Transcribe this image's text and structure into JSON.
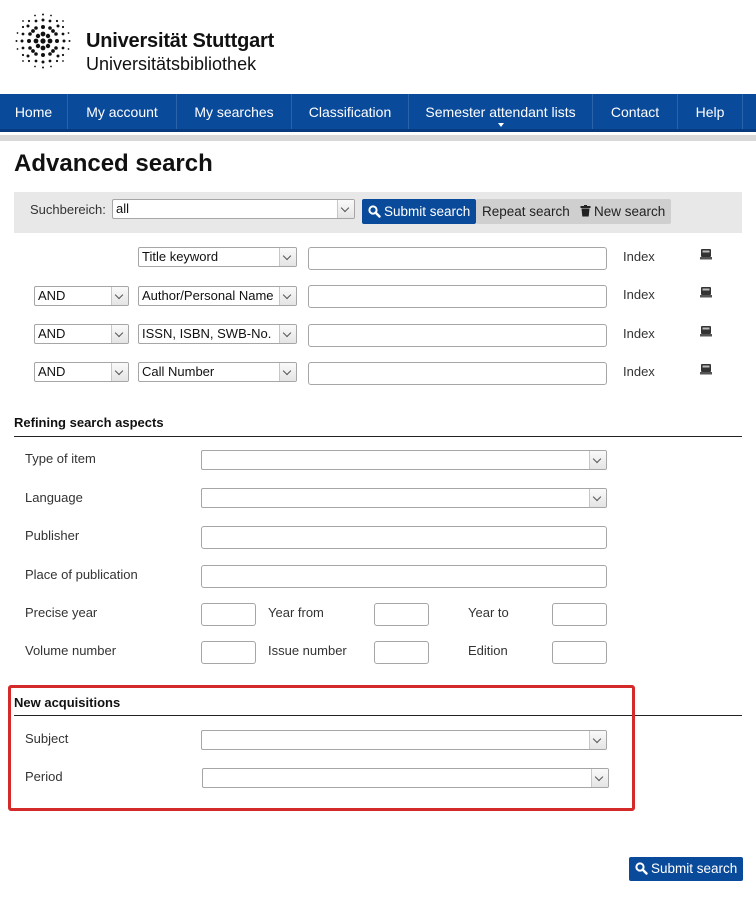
{
  "header": {
    "university": "Universität Stuttgart",
    "library": "Universitätsbibliothek"
  },
  "nav": {
    "items": [
      {
        "label": "Home"
      },
      {
        "label": "My account"
      },
      {
        "label": "My searches"
      },
      {
        "label": "Classification"
      },
      {
        "label": "Semester attendant lists"
      },
      {
        "label": "Contact"
      },
      {
        "label": "Help"
      }
    ]
  },
  "page": {
    "title": "Advanced search"
  },
  "searchbar": {
    "scope_label": "Suchbereich:",
    "scope_value": "all",
    "submit_label": "Submit search",
    "repeat_label": "Repeat search",
    "new_label": "New search"
  },
  "search_rows": [
    {
      "operator": "",
      "field": "Title keyword",
      "value": "",
      "index_label": "Index"
    },
    {
      "operator": "AND",
      "field": "Author/Personal Name",
      "value": "",
      "index_label": "Index"
    },
    {
      "operator": "AND",
      "field": "ISSN, ISBN, SWB-No.",
      "value": "",
      "index_label": "Index"
    },
    {
      "operator": "AND",
      "field": "Call Number",
      "value": "",
      "index_label": "Index"
    }
  ],
  "refine": {
    "title": "Refining search aspects",
    "type_of_item": "Type of item",
    "language": "Language",
    "publisher": "Publisher",
    "place": "Place of publication",
    "precise_year": "Precise year",
    "year_from": "Year from",
    "year_to": "Year to",
    "volume_number": "Volume number",
    "issue_number": "Issue number",
    "edition": "Edition"
  },
  "acquisitions": {
    "title": "New acquisitions",
    "subject": "Subject",
    "period": "Period"
  },
  "footer": {
    "submit_label": "Submit search"
  },
  "colors": {
    "brand_blue": "#0a4a9a",
    "highlight_red": "#d42a2a"
  }
}
